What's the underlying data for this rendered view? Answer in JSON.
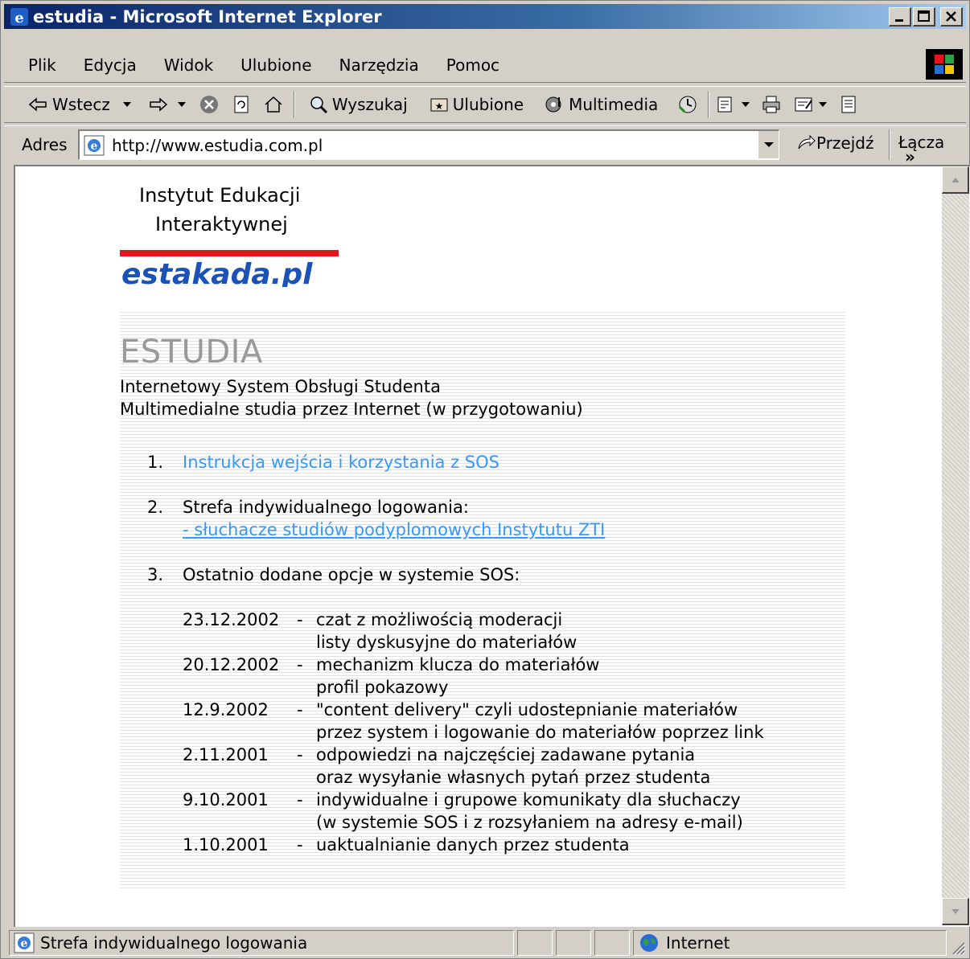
{
  "window": {
    "title": "estudia - Microsoft Internet Explorer",
    "minimize_label": "_",
    "maximize_label": "□",
    "close_label": "✕"
  },
  "menu": [
    "Plik",
    "Edycja",
    "Widok",
    "Ulubione",
    "Narzędzia",
    "Pomoc"
  ],
  "toolbar": {
    "back": "Wstecz",
    "search": "Wyszukaj",
    "favorites": "Ulubione",
    "media": "Multimedia"
  },
  "address": {
    "label": "Adres",
    "url": "http://www.estudia.com.pl",
    "go": "Przejdź",
    "links": "Łącza",
    "links_more": "»"
  },
  "page": {
    "institute_line1": "Instytut Edukacji",
    "institute_line2": "Interaktywnej",
    "logo_text": "estakada.pl",
    "logo_color": "#1a52b8",
    "logo_bar_color": "#e8141c",
    "heading": "ESTUDIA",
    "subtitle1": "Internetowy System Obsługi Studenta",
    "subtitle2": "Multimedialne studia przez Internet (w przygotowaniu)",
    "items": [
      {
        "num": "1.",
        "text": "Instrukcja wejścia i korzystania z SOS"
      },
      {
        "num": "2.",
        "text": "Strefa indywidualnego logowania:",
        "link": "- słuchacze studiów podyplomowych Instytutu ZTI"
      },
      {
        "num": "3.",
        "text": "Ostatnio dodane opcje w systemie SOS:"
      }
    ],
    "changelog": [
      {
        "date": "23.12.2002",
        "dash": "-",
        "lines": [
          "czat z możliwością moderacji",
          "listy dyskusyjne do materiałów"
        ]
      },
      {
        "date": "20.12.2002",
        "dash": "-",
        "lines": [
          "mechanizm klucza do materiałów",
          "profil pokazowy"
        ]
      },
      {
        "date": "12.9.2002",
        "dash": "-",
        "lines": [
          "\"content delivery\" czyli udostepnianie materiałów",
          "przez system i logowanie do materiałów poprzez link"
        ]
      },
      {
        "date": "2.11.2001",
        "dash": "-",
        "lines": [
          "odpowiedzi na najczęściej zadawane pytania",
          "oraz wysyłanie własnych pytań przez studenta"
        ]
      },
      {
        "date": "9.10.2001",
        "dash": "-",
        "lines": [
          "indywidualne i grupowe komunikaty dla słuchaczy",
          "(w systemie SOS i z rozsyłaniem na adresy e-mail)"
        ]
      },
      {
        "date": "1.10.2001",
        "dash": "-",
        "lines": [
          "uaktualnianie danych przez studenta"
        ]
      }
    ]
  },
  "status": {
    "text": "Strefa indywidualnego logowania",
    "zone": "Internet"
  },
  "colors": {
    "titlebar_start": "#0a246a",
    "link": "#3399ff",
    "heading_gray": "#999999"
  }
}
